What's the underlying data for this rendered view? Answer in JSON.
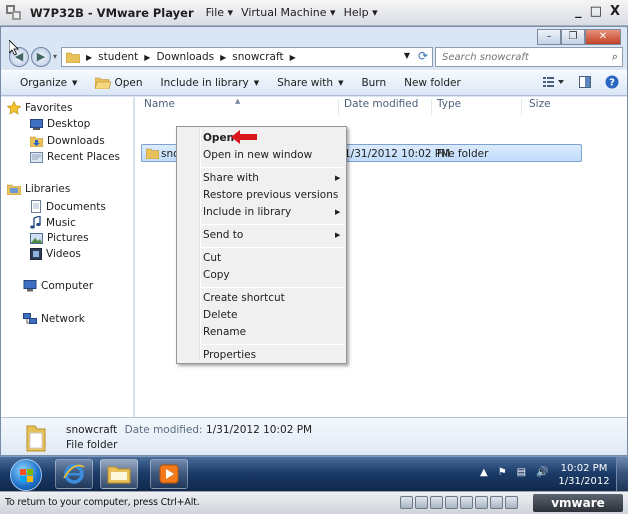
{
  "vm_window": {
    "title": "W7P32B - VMware Player",
    "menu": [
      "File ▾",
      "Virtual Machine ▾",
      "Help ▾"
    ],
    "controls": {
      "minimize": "_",
      "maximize": "□",
      "close": "X"
    }
  },
  "address_bar": {
    "crumbs": [
      "student",
      "Downloads",
      "snowcraft"
    ],
    "search_placeholder": "Search snowcraft"
  },
  "toolbar": {
    "organize": "Organize",
    "open": "Open",
    "include_in_library": "Include in library",
    "share_with": "Share with",
    "burn": "Burn",
    "new_folder": "New folder"
  },
  "sidebar": {
    "favorites": "Favorites",
    "desktop": "Desktop",
    "downloads": "Downloads",
    "recent_places": "Recent Places",
    "libraries": "Libraries",
    "documents": "Documents",
    "music": "Music",
    "pictures": "Pictures",
    "videos": "Videos",
    "computer": "Computer",
    "network": "Network"
  },
  "columns": {
    "name": "Name",
    "date_modified": "Date modified",
    "type": "Type",
    "size": "Size"
  },
  "files": [
    {
      "name": "snowcraft",
      "date_modified": "1/31/2012 10:02 PM",
      "type": "File folder",
      "size": ""
    }
  ],
  "context_menu": {
    "open": "Open",
    "open_new_window": "Open in new window",
    "share_with": "Share with",
    "restore_previous": "Restore previous versions",
    "include_in_library": "Include in library",
    "send_to": "Send to",
    "cut": "Cut",
    "copy": "Copy",
    "create_shortcut": "Create shortcut",
    "delete": "Delete",
    "rename": "Rename",
    "properties": "Properties"
  },
  "details_pane": {
    "name": "snowcraft",
    "date_label": "Date modified:",
    "date_value": "1/31/2012 10:02 PM",
    "type": "File folder"
  },
  "taskbar": {
    "time": "10:02 PM",
    "date": "1/31/2012"
  },
  "status_bar": {
    "message": "To return to your computer, press Ctrl+Alt.",
    "logo": "vmware"
  },
  "colors": {
    "selection": "#c1dcfc",
    "annotation_arrow": "#d8161b",
    "taskbar": "#1c3c6a"
  }
}
